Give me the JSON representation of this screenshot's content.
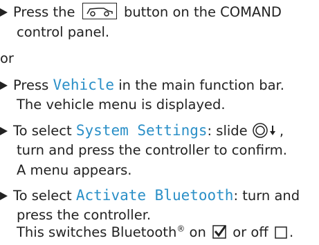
{
  "step1": {
    "pre": "Press the",
    "button_icon": "car-icon",
    "post": "button on the COMAND",
    "line2": "control panel."
  },
  "or_label": "or",
  "step2": {
    "pre": "Press",
    "term": "Vehicle",
    "post": "in the main function bar.",
    "line2": "The vehicle menu is displayed."
  },
  "step3": {
    "pre": "To select",
    "term": "System Settings",
    "post": ": slide",
    "controller_icon": "controller-slide-down-icon",
    "line2": "turn and press the controller to confirm.",
    "line3": "A menu appears."
  },
  "step4": {
    "pre": "To select",
    "term": "Activate Bluetooth",
    "post": ": turn and",
    "line2": "press the controller.",
    "line3_pre": "This switches Bluetooth",
    "line3_reg": "®",
    "line3_mid": "on",
    "line3_or": "or off",
    "checked_icon": "checkbox-checked-icon",
    "unchecked_icon": "checkbox-unchecked-icon"
  },
  "colors": {
    "term": "#2a8fc7",
    "text": "#222222"
  }
}
